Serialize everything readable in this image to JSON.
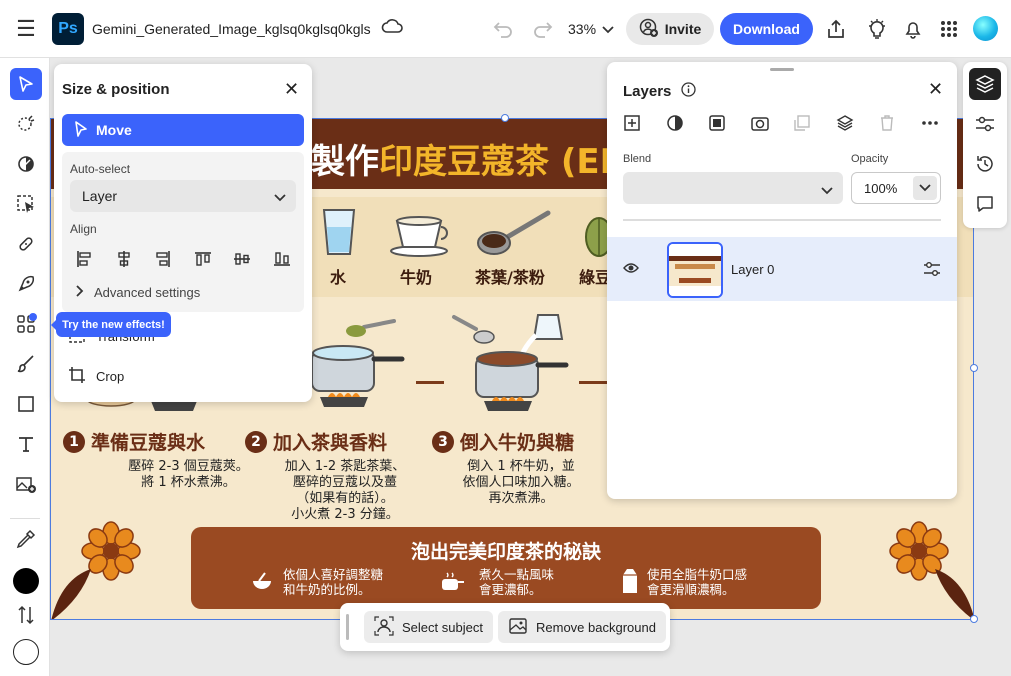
{
  "header": {
    "app_logo": "Ps",
    "file_name": "Gemini_Generated_Image_kglsq0kglsq0kgls",
    "zoom": "33%",
    "invite_label": "Invite",
    "download_label": "Download",
    "accent_color": "#3b63fb"
  },
  "left_toolbar": {
    "tools": [
      "move-tool-icon",
      "quick-selection-icon",
      "adjustments-icon",
      "object-select-icon",
      "healing-icon",
      "generative-icon",
      "effects-icon",
      "brush-icon",
      "shape-icon",
      "text-icon",
      "image-add-icon",
      "eyedropper-icon",
      "swap-colors-icon"
    ],
    "foreground_color": "#000000",
    "background_color": "#ffffff"
  },
  "size_panel": {
    "title": "Size & position",
    "move_label": "Move",
    "auto_select_label": "Auto-select",
    "auto_select_value": "Layer",
    "align_label": "Align",
    "advanced_label": "Advanced settings",
    "transform_label": "Transform",
    "crop_label": "Crop",
    "tooltip": "Try the new effects!"
  },
  "layers_panel": {
    "title": "Layers",
    "blend_label": "Blend",
    "blend_value": "",
    "opacity_label": "Opacity",
    "opacity_value": "100%",
    "layers": [
      {
        "name": "Layer 0",
        "visible": true
      }
    ]
  },
  "context_bar": {
    "select_subject_label": "Select subject",
    "remove_background_label": "Remove background"
  },
  "canvas": {
    "title_prefix": "製作",
    "title_accent": "印度豆蔻茶 (ELA",
    "ingredients": [
      "水",
      "牛奶",
      "茶葉/茶粉",
      "綠豆"
    ],
    "steps": [
      {
        "num": "1",
        "title": "準備豆蔻與水",
        "desc": "壓碎 2-3 個豆蔻莢。\n將 1 杯水煮沸。"
      },
      {
        "num": "2",
        "title": "加入茶與香料",
        "desc": "加入 1-2 茶匙茶葉、\n壓碎的豆蔻以及薑\n（如果有的話）。\n小火煮 2-3 分鐘。"
      },
      {
        "num": "3",
        "title": "倒入牛奶與糖",
        "desc": "倒入 1 杯牛奶，並\n依個人口味加入糖。\n再次煮沸。"
      }
    ],
    "tips_title": "泡出完美印度茶的秘訣",
    "tips": [
      "依個人喜好調整糖\n和牛奶的比例。",
      "煮久一點風味\n會更濃郁。",
      "使用全脂牛奶口感\n會更滑順濃稠。"
    ]
  }
}
